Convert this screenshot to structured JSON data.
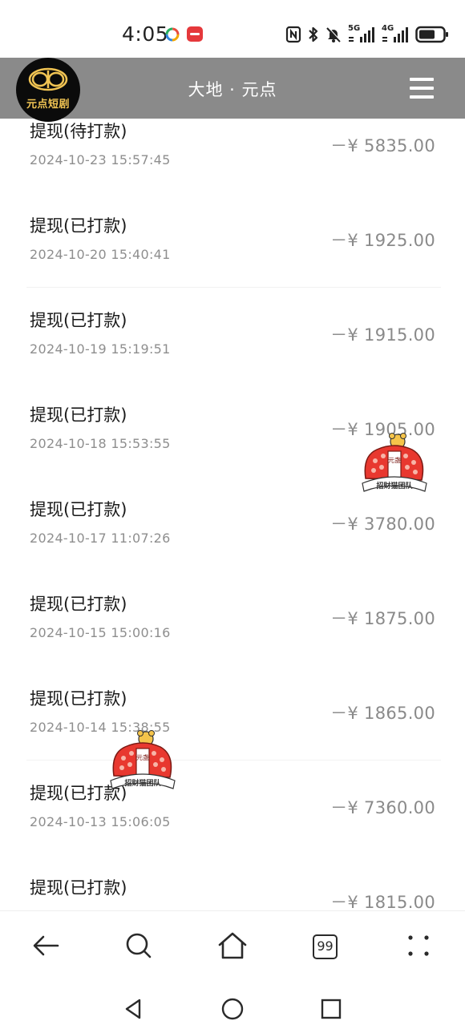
{
  "status_bar": {
    "time": "4:05",
    "network_1": "5G",
    "network_2": "4G"
  },
  "header": {
    "logo_text": "元点短剧",
    "title": "大地 · 元点"
  },
  "transactions": [
    {
      "title": "提现(待打款)",
      "date": "2024-10-23 15:57:45",
      "amount": "－¥ 5835.00"
    },
    {
      "title": "提现(已打款)",
      "date": "2024-10-20 15:40:41",
      "amount": "－¥ 1925.00"
    },
    {
      "title": "提现(已打款)",
      "date": "2024-10-19 15:19:51",
      "amount": "－¥ 1915.00"
    },
    {
      "title": "提现(已打款)",
      "date": "2024-10-18 15:53:55",
      "amount": "－¥ 1905.00"
    },
    {
      "title": "提现(已打款)",
      "date": "2024-10-17 11:07:26",
      "amount": "－¥ 3780.00"
    },
    {
      "title": "提现(已打款)",
      "date": "2024-10-15 15:00:16",
      "amount": "－¥ 1875.00"
    },
    {
      "title": "提现(已打款)",
      "date": "2024-10-14 15:38:55",
      "amount": "－¥ 1865.00"
    },
    {
      "title": "提现(已打款)",
      "date": "2024-10-13 15:06:05",
      "amount": "－¥ 7360.00"
    },
    {
      "title": "提现(已打款)",
      "date": "",
      "amount": "－¥ 1815.00"
    }
  ],
  "watermark": {
    "text": "招财猫团队",
    "inner_text": "元盏"
  },
  "toolbar": {
    "tab_count": "99"
  },
  "colors": {
    "header_bg": "#8a8a8a",
    "amount": "#8a8a8a",
    "date": "#8e8e8e",
    "logo_gold": "#f1c453"
  }
}
